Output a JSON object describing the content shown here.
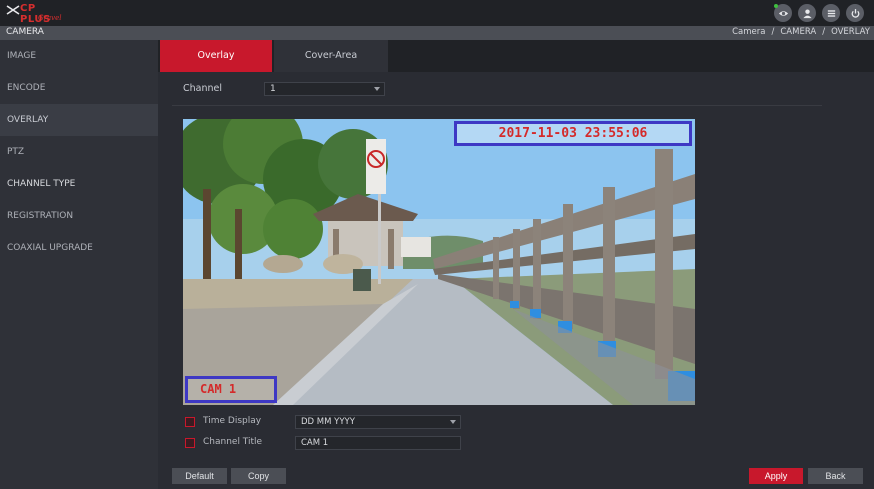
{
  "brand": {
    "name": "CP PLUS",
    "sub": "Gravel"
  },
  "header": {
    "icons": [
      "eye-icon",
      "user-icon",
      "list-icon",
      "power-icon"
    ]
  },
  "titlebar": {
    "title": "CAMERA",
    "breadcrumb": [
      "Camera",
      "/",
      "CAMERA",
      "/",
      "OVERLAY"
    ]
  },
  "sidebar": {
    "items": [
      {
        "label": "IMAGE"
      },
      {
        "label": "ENCODE"
      },
      {
        "label": "OVERLAY"
      },
      {
        "label": "PTZ"
      },
      {
        "label": "CHANNEL TYPE"
      },
      {
        "label": "REGISTRATION"
      },
      {
        "label": "COAXIAL UPGRADE"
      }
    ]
  },
  "tabs": [
    {
      "label": "Overlay"
    },
    {
      "label": "Cover-Area"
    }
  ],
  "channel": {
    "label": "Channel",
    "value": "1"
  },
  "preview": {
    "timestamp": "2017-11-03 23:55:06",
    "cam_title": "CAM 1"
  },
  "options": {
    "time_display": {
      "label": "Time Display",
      "value": "DD MM YYYY"
    },
    "channel_title": {
      "label": "Channel Title",
      "value": "CAM 1"
    }
  },
  "buttons": {
    "default": "Default",
    "copy": "Copy",
    "apply": "Apply",
    "back": "Back"
  },
  "colors": {
    "accent": "#c8182c",
    "overlay_box": "#3e38c4",
    "overlay_text": "#d42a2a"
  }
}
